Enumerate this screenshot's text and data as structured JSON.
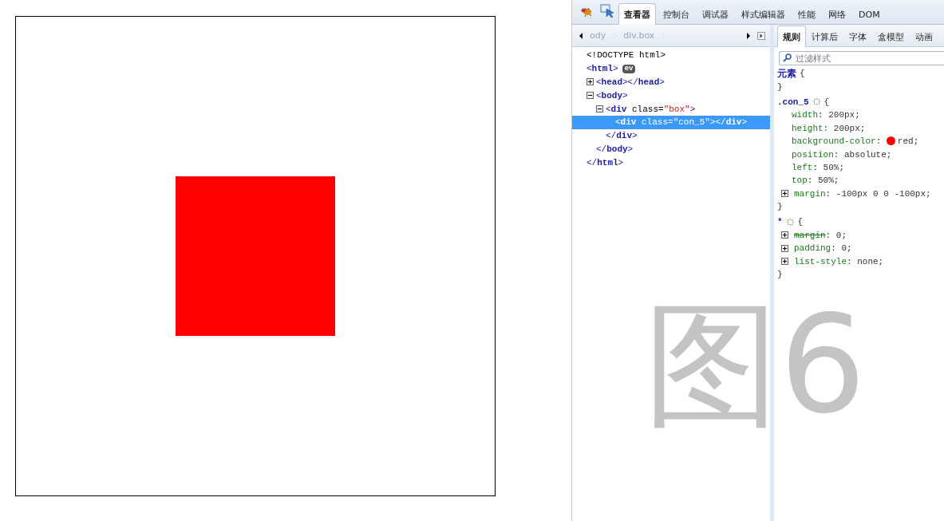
{
  "preview": {
    "kind": "square"
  },
  "toolbar": {
    "tabs": [
      {
        "label": "查看器",
        "selected": true
      },
      {
        "label": "控制台",
        "selected": false
      },
      {
        "label": "调试器",
        "selected": false
      },
      {
        "label": "样式编辑器",
        "selected": false
      },
      {
        "label": "性能",
        "selected": false
      },
      {
        "label": "网络",
        "selected": false
      },
      {
        "label": "DOM",
        "selected": false
      }
    ]
  },
  "breadcrumbs": [
    "ody",
    "div.box"
  ],
  "side_tabs": [
    {
      "label": "规则",
      "selected": true
    },
    {
      "label": "计算后",
      "selected": false
    },
    {
      "label": "字体",
      "selected": false
    },
    {
      "label": "盒模型",
      "selected": false
    },
    {
      "label": "动画",
      "selected": false
    }
  ],
  "markup": [
    {
      "parts": [
        {
          "kind": "plain",
          "text": "<!DOCTYPE html>"
        }
      ],
      "selected": false
    },
    {
      "parts": [
        {
          "kind": "bracket",
          "text": "<"
        },
        {
          "kind": "tag",
          "text": "html"
        },
        {
          "kind": "bracket",
          "text": ">"
        }
      ],
      "badge": "ev",
      "selected": false,
      "close": [
        {
          "kind": "bracket",
          "text": "</"
        },
        {
          "kind": "tag",
          "text": "html"
        },
        {
          "kind": "bracket",
          "text": ">"
        }
      ],
      "children": [
        {
          "parts": [
            {
              "kind": "bracket",
              "text": "<"
            },
            {
              "kind": "tag",
              "text": "head"
            },
            {
              "kind": "bracket",
              "text": "></"
            },
            {
              "kind": "tag",
              "text": "head"
            },
            {
              "kind": "bracket",
              "text": ">"
            }
          ],
          "expanded": false,
          "selected": false
        },
        {
          "parts": [
            {
              "kind": "bracket",
              "text": "<"
            },
            {
              "kind": "tag",
              "text": "body"
            },
            {
              "kind": "bracket",
              "text": ">"
            }
          ],
          "expanded": true,
          "selected": false,
          "close": [
            {
              "kind": "bracket",
              "text": "</"
            },
            {
              "kind": "tag",
              "text": "body"
            },
            {
              "kind": "bracket",
              "text": ">"
            }
          ],
          "children": [
            {
              "parts": [
                {
                  "kind": "bracket",
                  "text": "<"
                },
                {
                  "kind": "tag",
                  "text": "div"
                },
                {
                  "kind": "attr",
                  "text": " class="
                },
                {
                  "kind": "value",
                  "text": "\"box\""
                },
                {
                  "kind": "bracket",
                  "text": ">"
                }
              ],
              "expanded": true,
              "selected": false,
              "close": [
                {
                  "kind": "bracket",
                  "text": "</"
                },
                {
                  "kind": "tag",
                  "text": "div"
                },
                {
                  "kind": "bracket",
                  "text": ">"
                }
              ],
              "children": [
                {
                  "parts": [
                    {
                      "kind": "bracket",
                      "text": "<"
                    },
                    {
                      "kind": "tag",
                      "text": "div"
                    },
                    {
                      "kind": "attr",
                      "text": " class="
                    },
                    {
                      "kind": "value",
                      "text": "\"con_5\""
                    },
                    {
                      "kind": "bracket",
                      "text": "></"
                    },
                    {
                      "kind": "tag",
                      "text": "div"
                    },
                    {
                      "kind": "bracket",
                      "text": ">"
                    }
                  ],
                  "selected": true
                }
              ]
            }
          ]
        }
      ]
    }
  ],
  "rules": {
    "filter_placeholder": "过滤样式",
    "blocks": [
      {
        "selector": "元素",
        "has_icon": false,
        "open": "{",
        "close": "}"
      },
      {
        "selector": ".con_5",
        "has_icon": true,
        "open": "{",
        "close": "}",
        "declarations": [
          {
            "property": "width",
            "separator": ":",
            "value": "200px;",
            "expandable": false,
            "overridden": false
          },
          {
            "property": "height",
            "separator": ":",
            "value": "200px;",
            "expandable": false,
            "overridden": false
          },
          {
            "property": "background-color",
            "separator": ":",
            "value": "red;",
            "color": "#ff0000",
            "expandable": false,
            "overridden": false
          },
          {
            "property": "position",
            "separator": ":",
            "value": "absolute;",
            "expandable": false,
            "overridden": false
          },
          {
            "property": "left",
            "separator": ":",
            "value": "50%;",
            "expandable": false,
            "overridden": false
          },
          {
            "property": "top",
            "separator": ":",
            "value": "50%;",
            "expandable": false,
            "overridden": false
          },
          {
            "property": "margin",
            "separator": ":",
            "value": "-100px 0 0 -100px;",
            "expandable": true,
            "overridden": false
          }
        ]
      },
      {
        "selector": "*",
        "has_icon": true,
        "open": "{",
        "close": "}",
        "declarations": [
          {
            "property": "margin",
            "separator": ":",
            "value": "0;",
            "expandable": true,
            "overridden": true
          },
          {
            "property": "padding",
            "separator": ":",
            "value": "0;",
            "expandable": true,
            "overridden": false
          },
          {
            "property": "list-style",
            "separator": ":",
            "value": "none;",
            "expandable": true,
            "overridden": false
          }
        ]
      }
    ]
  },
  "figure_label": "图6"
}
